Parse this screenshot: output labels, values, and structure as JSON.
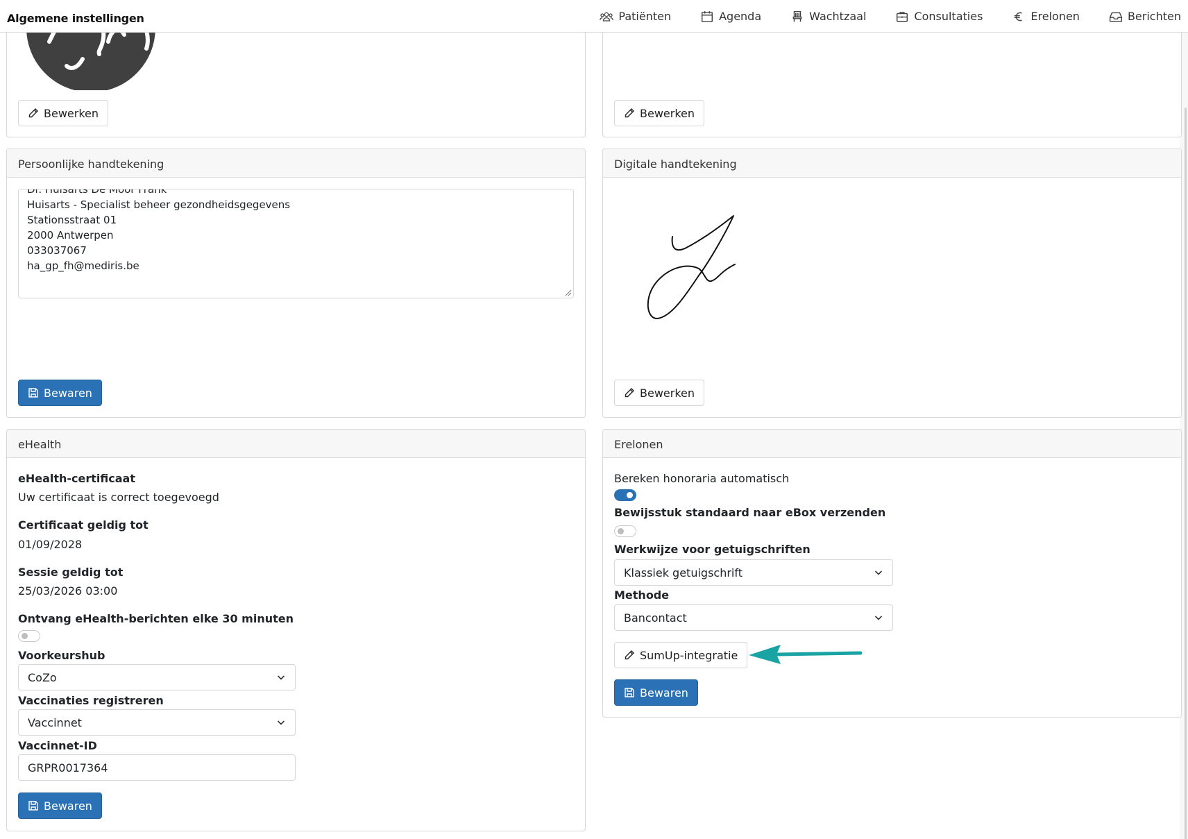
{
  "header": {
    "title": "Algemene instellingen",
    "nav": [
      {
        "label": "Patiënten",
        "icon": "users-icon"
      },
      {
        "label": "Agenda",
        "icon": "calendar-icon"
      },
      {
        "label": "Wachtzaal",
        "icon": "chair-icon"
      },
      {
        "label": "Consultaties",
        "icon": "briefcase-icon"
      },
      {
        "label": "Erelonen",
        "icon": "euro-icon"
      },
      {
        "label": "Berichten",
        "icon": "inbox-icon"
      }
    ]
  },
  "top_cards": {
    "left_edit_label": "Bewerken",
    "right_edit_label": "Bewerken"
  },
  "personal_signature": {
    "title": "Persoonlijke handtekening",
    "lines": [
      "Dr. Huisarts De Moor Frank",
      "Huisarts - Specialist beheer gezondheidsgegevens",
      "Stationsstraat 01",
      "2000 Antwerpen",
      "033037067",
      "ha_gp_fh@mediris.be"
    ],
    "save_label": "Bewaren"
  },
  "digital_signature": {
    "title": "Digitale handtekening",
    "edit_label": "Bewerken"
  },
  "ehealth": {
    "title": "eHealth",
    "certificate_label": "eHealth-certificaat",
    "certificate_status": "Uw certificaat is correct toegevoegd",
    "valid_until_label": "Certificaat geldig tot",
    "valid_until": "01/09/2028",
    "session_label": "Sessie geldig tot",
    "session_until": "25/03/2026 03:00",
    "receive_label": "Ontvang eHealth-berichten elke 30 minuten",
    "receive_enabled": false,
    "hub_label": "Voorkeurshub",
    "hub_value": "CoZo",
    "vacc_label": "Vaccinaties registreren",
    "vacc_value": "Vaccinnet",
    "vacc_id_label": "Vaccinnet-ID",
    "vacc_id_value": "GRPR0017364",
    "save_label": "Bewaren"
  },
  "fees": {
    "title": "Erelonen",
    "auto_label": "Bereken honoraria automatisch",
    "auto_enabled": true,
    "ebox_label": "Bewijsstuk standaard naar eBox verzenden",
    "ebox_enabled": false,
    "method_label": "Werkwijze voor getuigschriften",
    "method_value": "Klassiek getuigschrift",
    "payment_label": "Methode",
    "payment_value": "Bancontact",
    "sumup_label": "SumUp-integratie",
    "save_label": "Bewaren",
    "arrow_color": "#1aa3a3"
  },
  "colors": {
    "primary": "#2a72b5",
    "annotation_arrow": "#1aa3a3"
  }
}
